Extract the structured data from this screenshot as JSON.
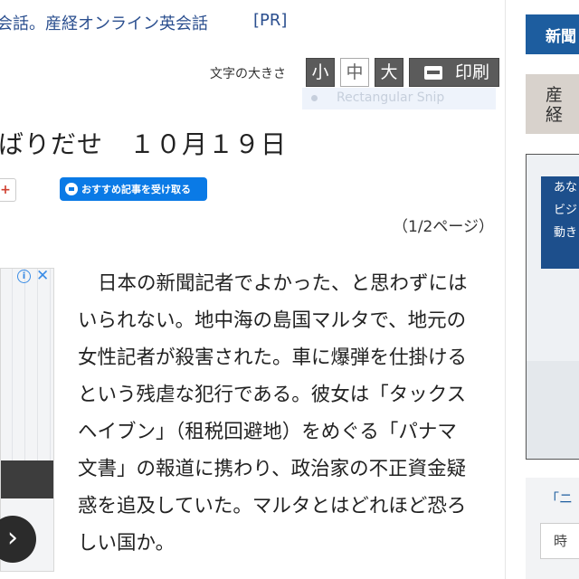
{
  "promo": {
    "link_text": "会話。産経オンライン英会話",
    "pr_tag": "[PR]"
  },
  "font_size_controls": {
    "label": "文字の大きさ",
    "small": "小",
    "medium": "中",
    "large": "大",
    "print": "印刷"
  },
  "snip_tooltip": {
    "label": "Rectangular Snip"
  },
  "article": {
    "title": "ばりだせ　１０月１９日",
    "share_plus": "+",
    "recommend_button": "おすすめ記事を受け取る",
    "page_indicator": "（1/2ページ）",
    "body_lines": [
      "日本の新聞記者でよかった、と思わずには",
      "いられない。地中海の島国マルタで、地元の",
      "女性記者が殺害された。車に爆弾を仕掛ける",
      "という残虐な犯行である。彼女は「タックス",
      "ヘイブン」（租税回避地）をめぐる「パナマ",
      "文書」の報道に携わり、政治家の不正資金疑",
      "惑を追及していた。マルタとはどれほど恐ろ",
      "しい国か。"
    ]
  },
  "ad": {
    "info": "i",
    "close": "✕",
    "next": "›"
  },
  "sidebar": {
    "header_label": "新聞",
    "thumb_text": "産経",
    "banner_lines": [
      "あな",
      "ビジ",
      "動き"
    ],
    "box_title": "「ニ",
    "box_text": "時"
  }
}
